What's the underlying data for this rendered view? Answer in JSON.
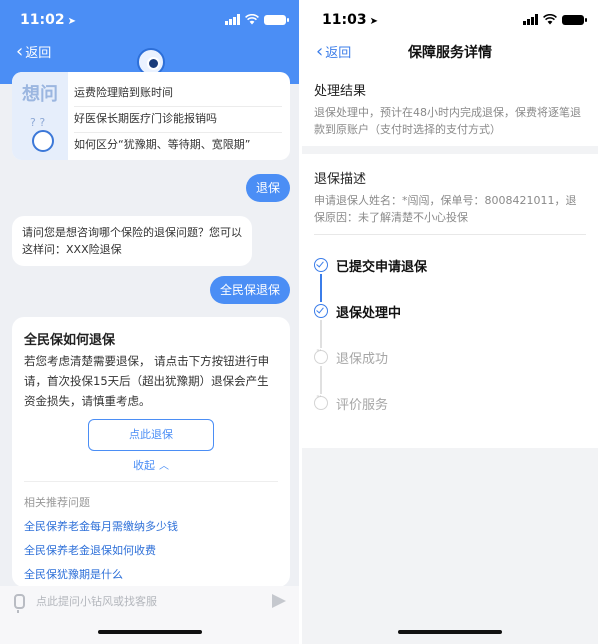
{
  "left": {
    "status_time": "11:02",
    "back_label": "返回",
    "faq_title_deco": "想问",
    "faq_deco_marks": "? ?",
    "faq_items": [
      "运费险理赔到账时间",
      "好医保长期医疗门诊能报销吗",
      "如何区分“犹豫期、等待期、宽限期”"
    ],
    "user_message_1": "退保",
    "bot_message_1": "请问您是想咨询哪个保险的退保问题？您可以这样问：XXX险退保",
    "user_message_2": "全民保退保",
    "answer": {
      "title": "全民保如何退保",
      "body": "若您考虑清楚需要退保， 请点击下方按钮进行申请，首次投保15天后（超出犹豫期）退保会产生资金损失，请慎重考虑。",
      "button_label": "点此退保",
      "collapse_label": "收起",
      "related_title": "相关推荐问题",
      "related_links": [
        "全民保养老金每月需缴纳多少钱",
        "全民保养老金退保如何收费",
        "全民保犹豫期是什么"
      ]
    },
    "input_placeholder": "点此提问小钻风或找客服"
  },
  "right": {
    "status_time": "11:03",
    "back_label": "返回",
    "title": "保障服务详情",
    "result_title": "处理结果",
    "result_text": "退保处理中，预计在48小时内完成退保，保费将逐笔退款到原账户（支付时选择的支付方式）",
    "desc_title": "退保描述",
    "desc_text": "申请退保人姓名：*闯闯，保单号：8008421011，退保原因：未了解清楚不小心投保",
    "steps": [
      {
        "label": "已提交申请退保",
        "state": "done"
      },
      {
        "label": "退保处理中",
        "state": "done"
      },
      {
        "label": "退保成功",
        "state": "todo"
      },
      {
        "label": "评价服务",
        "state": "todo"
      }
    ]
  },
  "colors": {
    "accent": "#4b8ef5",
    "link_blue": "#3b7de9",
    "chat_background": "#eef0f4"
  },
  "icons": [
    "location-arrow-icon",
    "signal-icon",
    "wifi-icon",
    "battery-icon",
    "back-chevron-icon",
    "robot-avatar-icon",
    "chevron-up-icon",
    "microphone-icon",
    "send-icon",
    "check-circle-icon",
    "pending-circle-icon"
  ]
}
